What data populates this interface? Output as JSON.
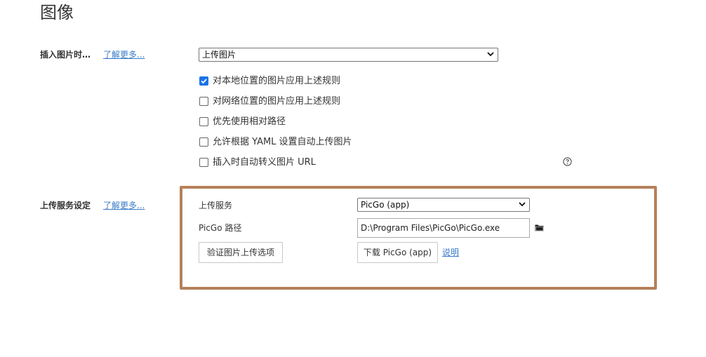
{
  "page": {
    "title": "图像"
  },
  "insert_image": {
    "label": "插入图片时…",
    "learn_more": "了解更多...",
    "action_selected": "上传图片",
    "options": [
      {
        "label": "对本地位置的图片应用上述规则",
        "checked": true
      },
      {
        "label": "对网络位置的图片应用上述规则",
        "checked": false
      },
      {
        "label": "优先使用相对路径",
        "checked": false
      },
      {
        "label": "允许根据 YAML 设置自动上传图片",
        "checked": false
      },
      {
        "label": "插入时自动转义图片 URL",
        "checked": false
      }
    ],
    "help_icon": "question-circle-icon"
  },
  "upload_service": {
    "label": "上传服务设定",
    "learn_more": "了解更多...",
    "service_label": "上传服务",
    "service_selected": "PicGo (app)",
    "path_label": "PicGo 路径",
    "path_value": "D:\\Program Files\\PicGo\\PicGo.exe",
    "folder_icon": "folder-icon",
    "verify_button": "验证图片上传选项",
    "download_button": "下载 PicGo (app)",
    "help_link": "说明",
    "highlight_color": "#b5805a"
  },
  "colors": {
    "link": "#3a7bc8",
    "checkbox_checked": "#1a73e8"
  }
}
